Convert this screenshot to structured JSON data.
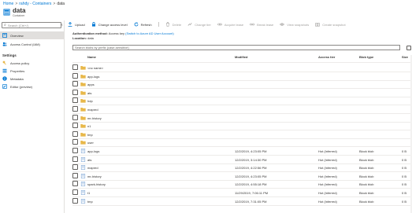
{
  "breadcrumb": [
    {
      "label": "Home"
    },
    {
      "label": "rahdy - Containers"
    },
    {
      "label": "data"
    }
  ],
  "header": {
    "title": "data",
    "subtitle": "Container"
  },
  "sidebar": {
    "search_placeholder": "Search (Ctrl+/)",
    "items": [
      {
        "label": "Overview",
        "icon": "overview-icon"
      },
      {
        "label": "Access Control (IAM)",
        "icon": "people-icon"
      }
    ],
    "section_title": "Settings",
    "settings_items": [
      {
        "label": "Access policy",
        "icon": "key-icon"
      },
      {
        "label": "Properties",
        "icon": "properties-icon"
      },
      {
        "label": "Metadata",
        "icon": "info-icon"
      },
      {
        "label": "Editor (preview)",
        "icon": "edit-icon"
      }
    ]
  },
  "toolbar": {
    "upload": "Upload",
    "change_access": "Change access level",
    "refresh": "Refresh",
    "delete": "Delete",
    "change_tier": "Change tier",
    "acquire_lease": "Acquire lease",
    "break_lease": "Break lease",
    "view_snapshots": "View snapshots",
    "create_snapshot": "Create snapshot"
  },
  "auth": {
    "label": "Authentication method:",
    "value": "Access key",
    "link": "(Switch to Azure AD User Account)",
    "location_label": "Location:",
    "location_value": "data"
  },
  "search": {
    "placeholder": "Search blobs by prefix (case-sensitive)"
  },
  "table": {
    "headers": {
      "name": "Name",
      "modified": "Modified",
      "access_tier": "Access tier",
      "blob_type": "Blob type",
      "size": "Size"
    },
    "rows": [
      {
        "type": "folder",
        "name": "<no name>",
        "modified": "",
        "access_tier": "",
        "blob_type": "",
        "size": ""
      },
      {
        "type": "folder",
        "name": "app-logs",
        "modified": "",
        "access_tier": "",
        "blob_type": "",
        "size": ""
      },
      {
        "type": "folder",
        "name": "apps",
        "modified": "",
        "access_tier": "",
        "blob_type": "",
        "size": ""
      },
      {
        "type": "folder",
        "name": "ats",
        "modified": "",
        "access_tier": "",
        "blob_type": "",
        "size": ""
      },
      {
        "type": "folder",
        "name": "hdp",
        "modified": "",
        "access_tier": "",
        "blob_type": "",
        "size": ""
      },
      {
        "type": "folder",
        "name": "mapred",
        "modified": "",
        "access_tier": "",
        "blob_type": "",
        "size": ""
      },
      {
        "type": "folder",
        "name": "mr-history",
        "modified": "",
        "access_tier": "",
        "blob_type": "",
        "size": ""
      },
      {
        "type": "folder",
        "name": "n1",
        "modified": "",
        "access_tier": "",
        "blob_type": "",
        "size": ""
      },
      {
        "type": "folder",
        "name": "tmp",
        "modified": "",
        "access_tier": "",
        "blob_type": "",
        "size": ""
      },
      {
        "type": "folder",
        "name": "user",
        "modified": "",
        "access_tier": "",
        "blob_type": "",
        "size": ""
      },
      {
        "type": "file",
        "name": "app-logs",
        "modified": "12/2/2019, 4:23:05 PM",
        "access_tier": "Hot (Inferred)",
        "blob_type": "Block blob",
        "size": "0 B"
      },
      {
        "type": "file",
        "name": "ats",
        "modified": "12/2/2019, 3:14:30 PM",
        "access_tier": "Hot (Inferred)",
        "blob_type": "Block blob",
        "size": "0 B"
      },
      {
        "type": "file",
        "name": "mapred",
        "modified": "12/2/2019, 4:22:56 PM",
        "access_tier": "Hot (Inferred)",
        "blob_type": "Block blob",
        "size": "0 B"
      },
      {
        "type": "file",
        "name": "mr-history",
        "modified": "12/2/2019, 4:23:05 PM",
        "access_tier": "Hot (Inferred)",
        "blob_type": "Block blob",
        "size": "0 B"
      },
      {
        "type": "file",
        "name": "spark-history",
        "modified": "12/2/2019, 4:55:18 PM",
        "access_tier": "Hot (Inferred)",
        "blob_type": "Block blob",
        "size": "0 B"
      },
      {
        "type": "file",
        "name": "t1",
        "modified": "11/29/2019, 7:06:11 PM",
        "access_tier": "Hot (Inferred)",
        "blob_type": "Block blob",
        "size": "0 B"
      },
      {
        "type": "file",
        "name": "tmp",
        "modified": "12/2/2019, 7:31:05 PM",
        "access_tier": "Hot (Inferred)",
        "blob_type": "Block blob",
        "size": "0 B"
      }
    ]
  },
  "colors": {
    "accent": "#0078d4",
    "folder": "#e8b84a",
    "file": "#7fa7d6"
  }
}
